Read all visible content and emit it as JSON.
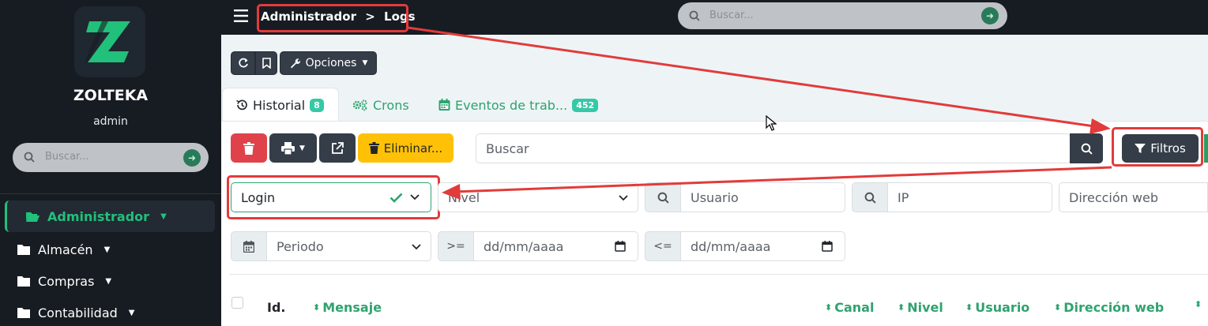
{
  "sidebar": {
    "brand": "ZOLTEKA",
    "user": "admin",
    "search_placeholder": "Buscar...",
    "items": [
      {
        "label": "Administrador",
        "active": true
      },
      {
        "label": "Almacén"
      },
      {
        "label": "Compras"
      },
      {
        "label": "Contabilidad"
      }
    ]
  },
  "topbar": {
    "breadcrumb": {
      "parent": "Administrador",
      "separator": ">",
      "current": "Logs"
    },
    "search_placeholder": "Buscar..."
  },
  "toolbar": {
    "options_label": "Opciones"
  },
  "tabs": [
    {
      "label": "Historial",
      "badge": "8",
      "active": true
    },
    {
      "label": "Crons"
    },
    {
      "label": "Eventos de trab...",
      "badge": "452"
    }
  ],
  "actions": {
    "delete_selected_label": "Eliminar...",
    "search_placeholder": "Buscar",
    "filters_label": "Filtros"
  },
  "filters": {
    "channel_value": "Login",
    "level_placeholder": "Nivel",
    "user_placeholder": "Usuario",
    "ip_placeholder": "IP",
    "url_placeholder": "Dirección web",
    "period_placeholder": "Periodo",
    "gte_label": ">=",
    "lte_label": "<=",
    "date_from_placeholder": "dd/mm/aaaa",
    "date_to_placeholder": "dd/mm/aaaa"
  },
  "table": {
    "columns": [
      "Id.",
      "Mensaje",
      "Canal",
      "Nivel",
      "Usuario",
      "Dirección web"
    ]
  },
  "colors": {
    "sidebar_bg": "#171c22",
    "accent_green": "#2ea36f",
    "danger": "#e0424c",
    "warning": "#ffc107",
    "dark_button": "#343d48",
    "annotation_red": "#e23b3b",
    "badge_teal": "#35c9a6"
  }
}
